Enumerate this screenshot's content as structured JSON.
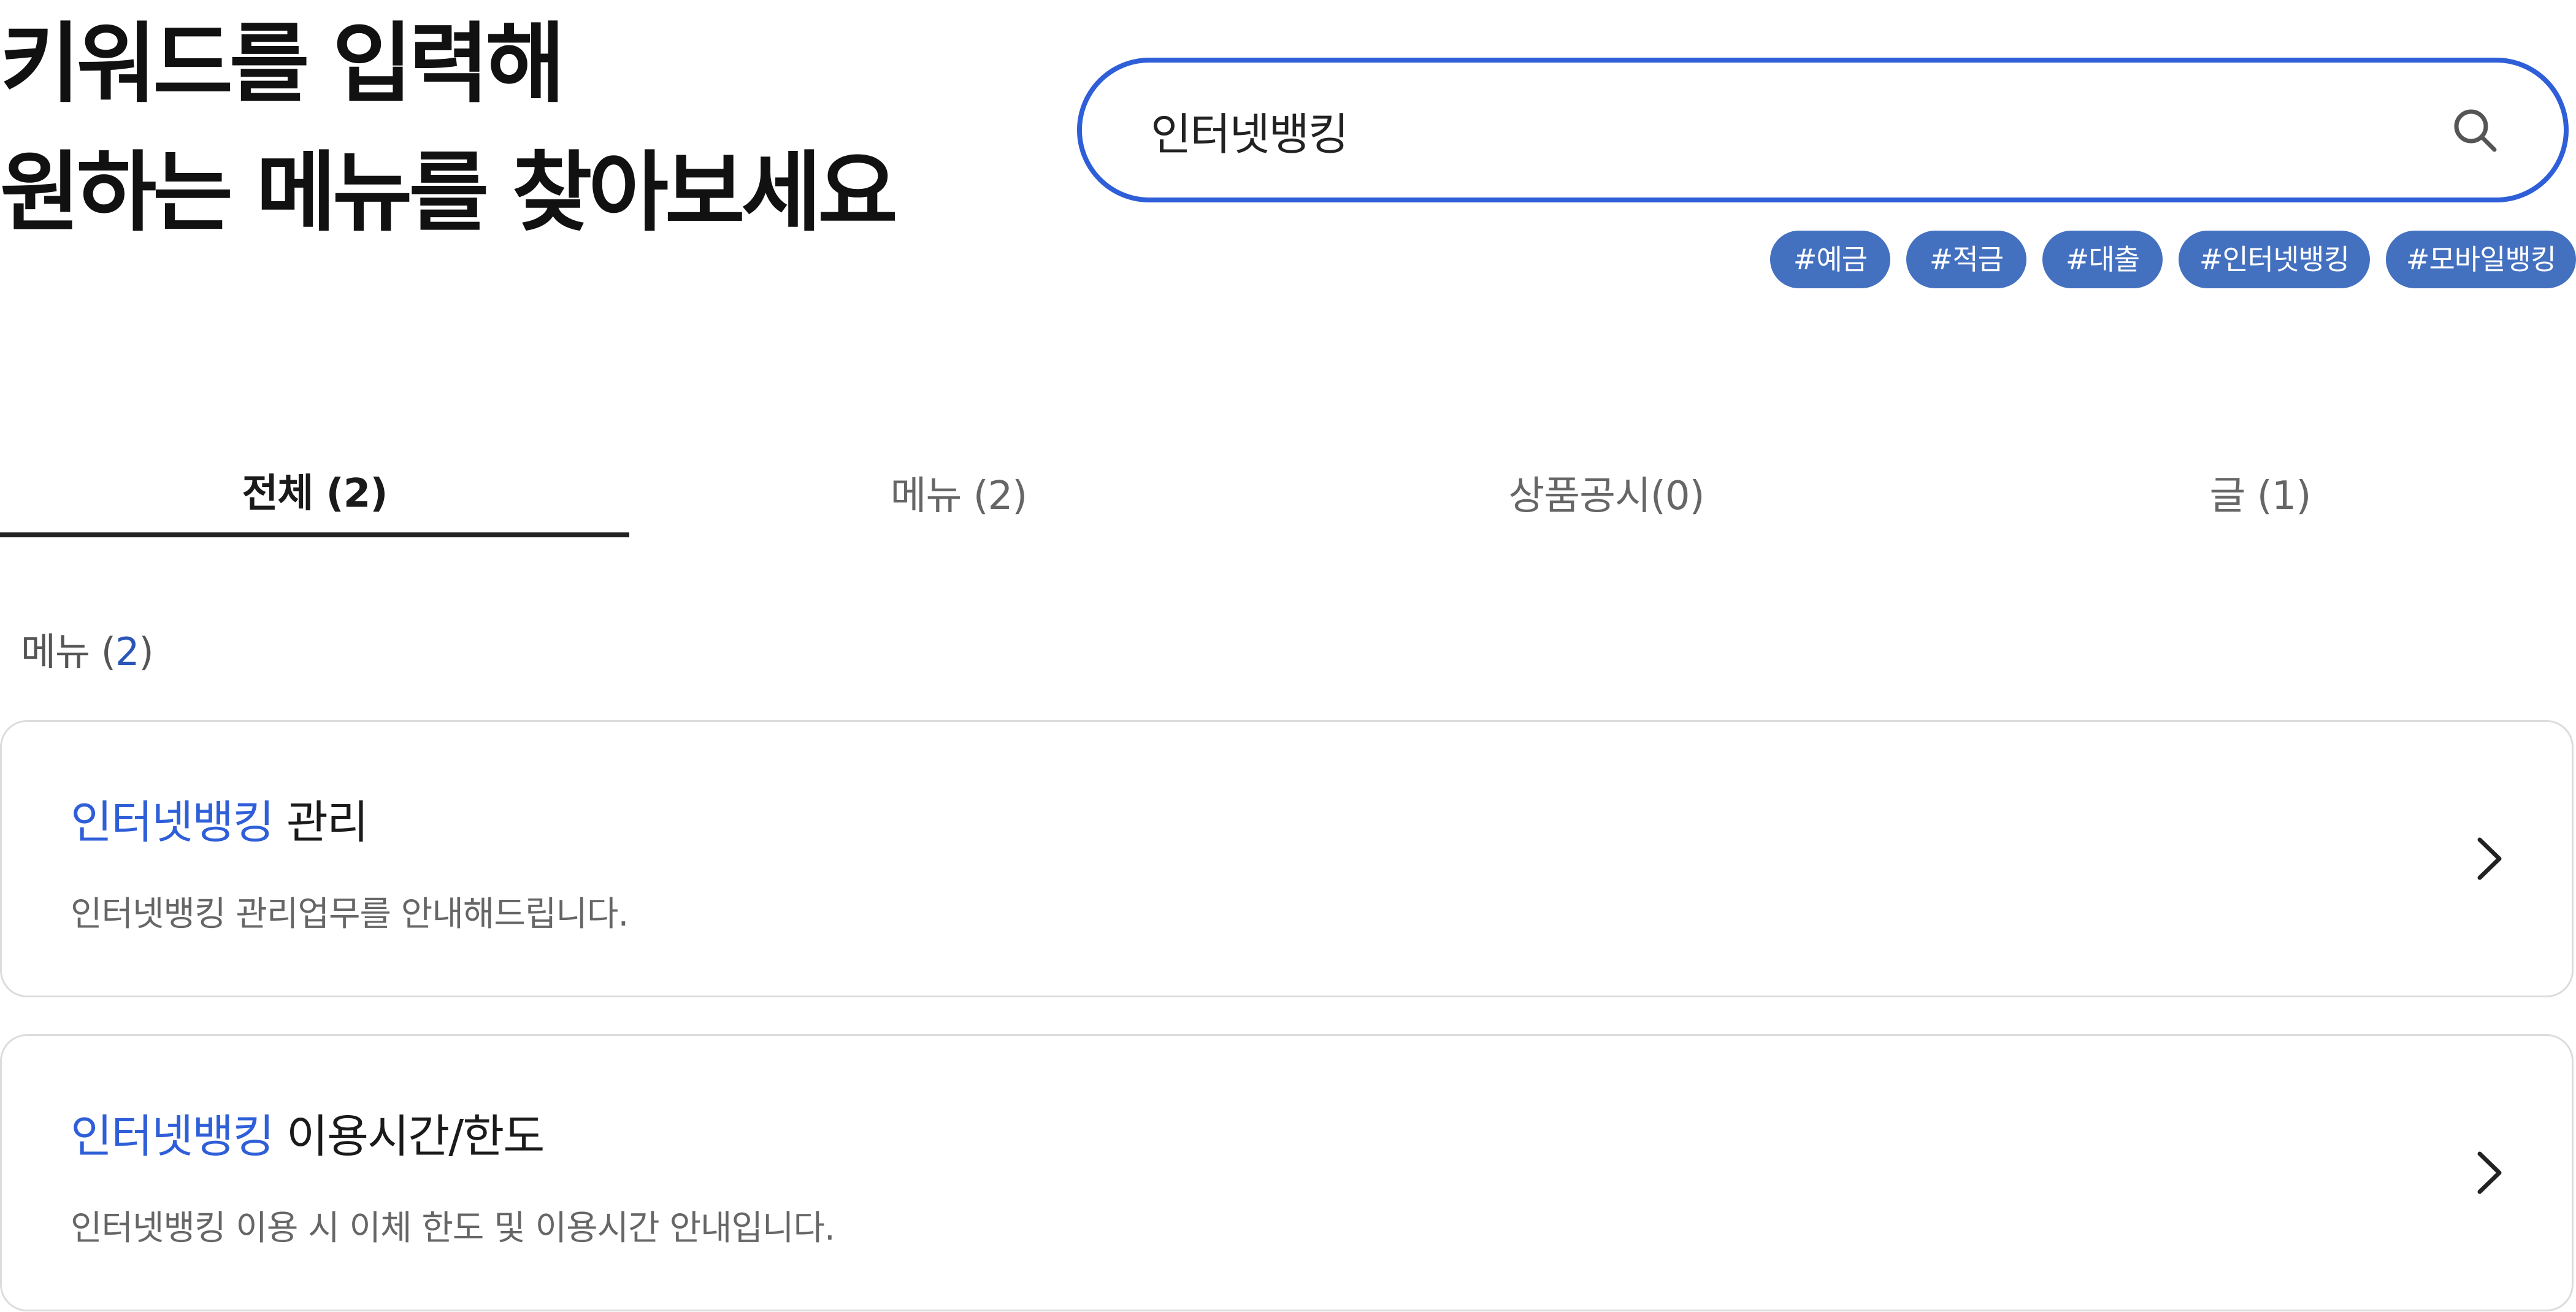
{
  "headline": {
    "line1": "키워드를 입력해",
    "line2": "원하는 메뉴를 찾아보세요"
  },
  "search": {
    "value": "인터넷뱅킹",
    "icon": "search-icon"
  },
  "tags": [
    "#예금",
    "#적금",
    "#대출",
    "#인터넷뱅킹",
    "#모바일뱅킹"
  ],
  "tabs": [
    {
      "label": "전체 (2)",
      "active": true
    },
    {
      "label": "메뉴 (2)",
      "active": false
    },
    {
      "label": "상품공시(0)",
      "active": false
    },
    {
      "label": "글 (1)",
      "active": false
    }
  ],
  "section": {
    "label": "메뉴",
    "count": "2"
  },
  "results": [
    {
      "highlight": "인터넷뱅킹",
      "title_rest": " 관리",
      "description": "인터넷뱅킹 관리업무를 안내해드립니다."
    },
    {
      "highlight": "인터넷뱅킹",
      "title_rest": " 이용시간/한도",
      "description": "인터넷뱅킹 이용 시 이체 한도 및 이용시간 안내입니다."
    }
  ],
  "colors": {
    "accent": "#2f5fd8",
    "tag_bg": "#4470c0",
    "count": "#2a56b8"
  }
}
